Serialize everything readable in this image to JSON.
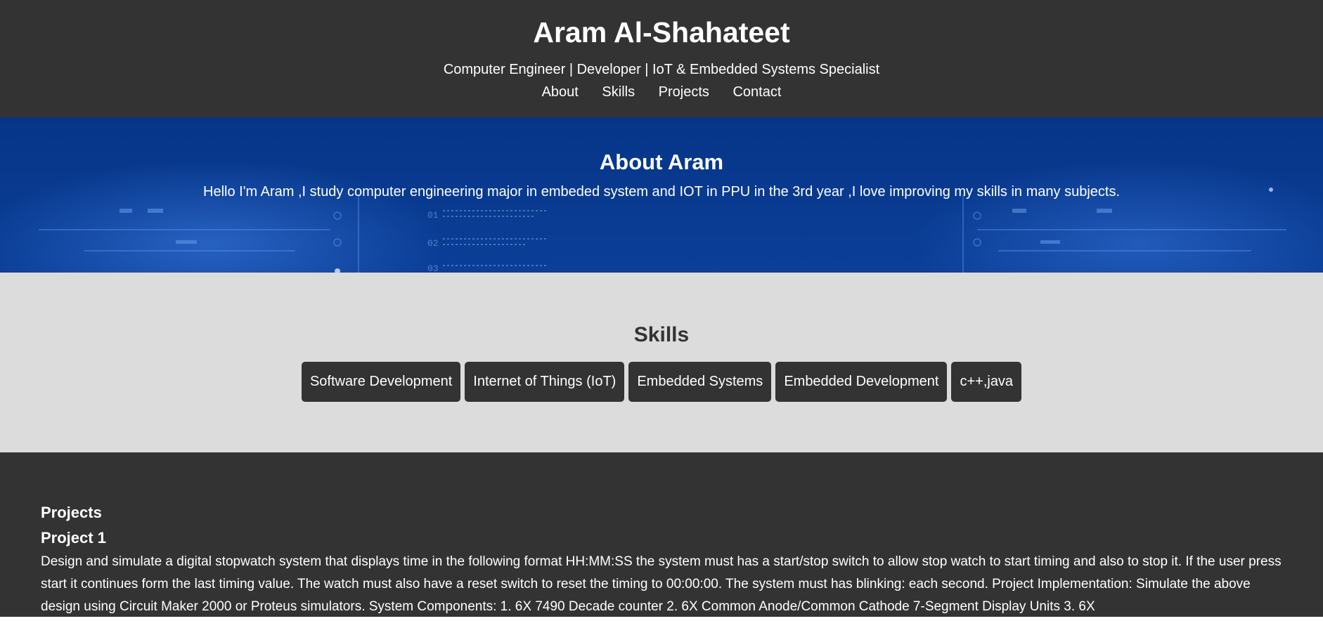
{
  "header": {
    "title": "Aram Al-Shahateet",
    "tagline": "Computer Engineer | Developer | IoT & Embedded Systems Specialist",
    "nav": [
      "About",
      "Skills",
      "Projects",
      "Contact"
    ]
  },
  "about": {
    "heading": "About Aram",
    "text": "Hello I'm Aram ,I study computer engineering major in embeded system and IOT in PPU in the 3rd year ,I love improving my skills in many subjects.",
    "bg_labels": [
      "01",
      "02",
      "03"
    ]
  },
  "skills": {
    "heading": "Skills",
    "items": [
      "Software Development",
      "Internet of Things (IoT)",
      "Embedded Systems",
      "Embedded Development",
      "c++,java"
    ]
  },
  "projects": {
    "heading": "Projects",
    "items": [
      {
        "title": "Project 1",
        "description": "Design and simulate a digital stopwatch system that displays time in the following format HH:MM:SS the system must has a start/stop switch to allow stop watch to start timing and also to stop it. If the user press start it continues form the last timing value. The watch must also have a reset switch to reset the timing to 00:00:00. The system must has blinking: each second. Project Implementation: Simulate the above design using Circuit Maker 2000 or Proteus simulators. System Components: 1. 6X 7490 Decade counter 2. 6X Common Anode/Common Cathode 7-Segment Display Units 3. 6X"
      }
    ]
  },
  "colors": {
    "header_bg": "#333333",
    "about_bg": "#0a3a8f",
    "skills_bg": "#dcdcdc",
    "skill_chip_bg": "#333333",
    "text_light": "#ffffff"
  }
}
